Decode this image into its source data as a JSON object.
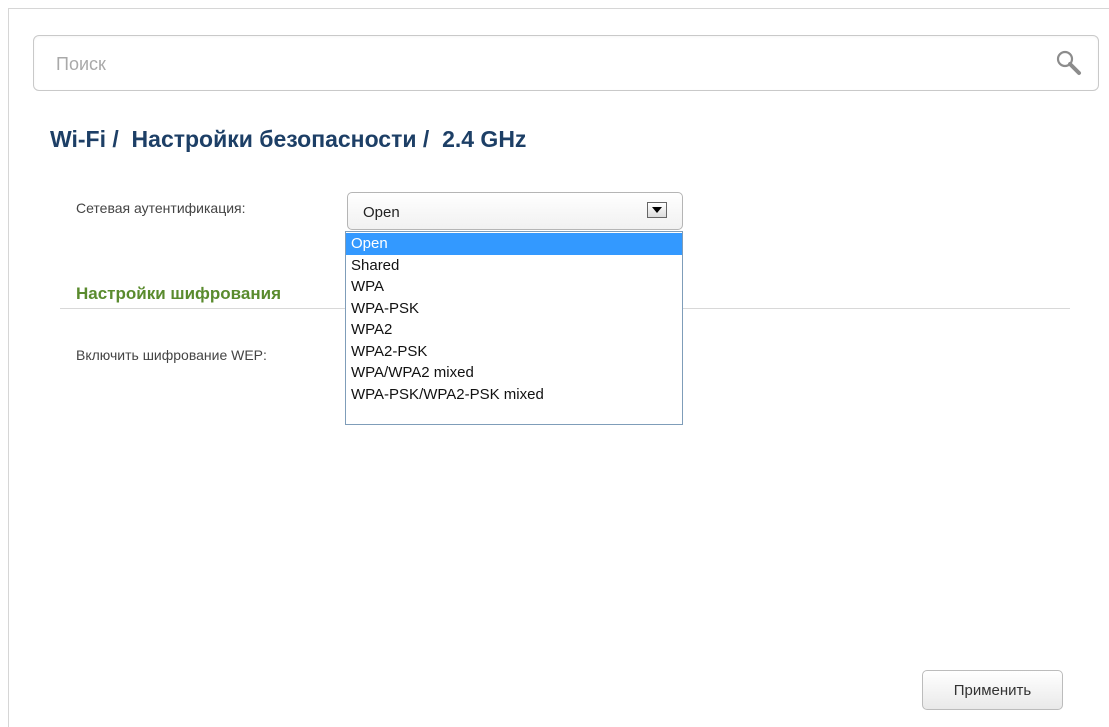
{
  "search": {
    "placeholder": "Поиск",
    "value": ""
  },
  "page": {
    "title": "Wi-Fi /  Настройки безопасности /  2.4 GHz"
  },
  "auth": {
    "label": "Сетевая аутентификация:",
    "selected": "Open",
    "options": [
      "Open",
      "Shared",
      "WPA",
      "WPA-PSK",
      "WPA2",
      "WPA2-PSK",
      "WPA/WPA2 mixed",
      "WPA-PSK/WPA2-PSK mixed"
    ],
    "highlighted_index": 0
  },
  "encryption": {
    "heading": "Настройки шифрования",
    "wep_label": "Включить шифрование WEP:"
  },
  "actions": {
    "apply_label": "Применить"
  },
  "colors": {
    "title": "#1d3f66",
    "section_heading": "#5a8b2e",
    "dropdown_highlight": "#3399ff"
  }
}
